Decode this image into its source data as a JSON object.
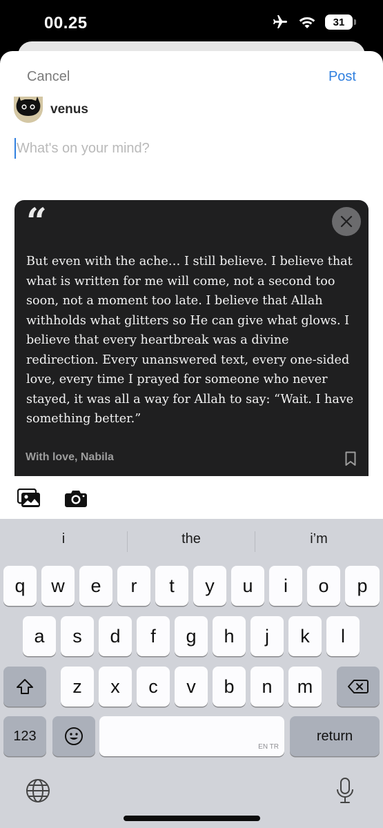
{
  "status_bar": {
    "time": "00.25",
    "battery": "31"
  },
  "header": {
    "cancel_label": "Cancel",
    "post_label": "Post"
  },
  "user": {
    "name": "venus"
  },
  "compose": {
    "placeholder": "What's on your mind?"
  },
  "quote": {
    "text": "But even with the ache… I still believe. I believe that what is written for me will come, not a second too soon, not a moment too late. I believe that Allah withholds what glitters so He can give what glows. I believe that every heartbreak was a divine redirection. Every unanswered text, every one-sided love, every time I prayed for someone who never stayed, it was all a way for Allah to say: “Wait. I have something better.”",
    "attribution": "With love, Nabila"
  },
  "keyboard": {
    "suggestions": [
      "i",
      "the",
      "i’m"
    ],
    "row1": [
      "q",
      "w",
      "e",
      "r",
      "t",
      "y",
      "u",
      "i",
      "o",
      "p"
    ],
    "row2": [
      "a",
      "s",
      "d",
      "f",
      "g",
      "h",
      "j",
      "k",
      "l"
    ],
    "row3": [
      "z",
      "x",
      "c",
      "v",
      "b",
      "n",
      "m"
    ],
    "numbers_label": "123",
    "return_label": "return",
    "space_languages": "EN TR"
  },
  "icons": {
    "airplane": "airplane-icon",
    "wifi": "wifi-icon",
    "quote": "quote-icon",
    "close": "close-icon",
    "bookmark": "bookmark-icon",
    "gallery": "photo-gallery-icon",
    "camera": "camera-icon",
    "shift": "shift-icon",
    "backspace": "backspace-icon",
    "emoji": "emoji-icon",
    "globe": "globe-icon",
    "mic": "microphone-icon"
  },
  "colors": {
    "accent": "#2f7fdf",
    "quote_card": "#1f1f20",
    "keyboard_bg": "#d1d3d9"
  }
}
